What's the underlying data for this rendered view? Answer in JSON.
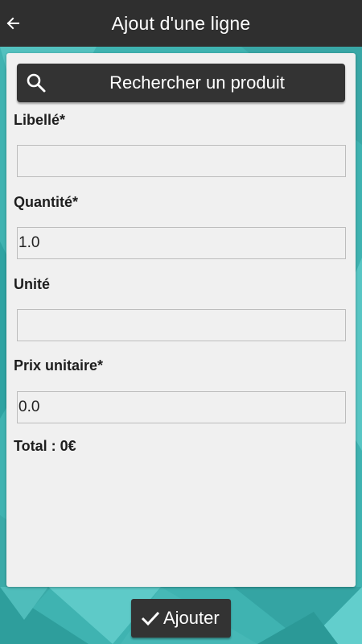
{
  "colors": {
    "appbar": "#2f2f2f",
    "background": "#3fb3b1",
    "card": "#f0f0f0",
    "button": "#333333",
    "button_text": "#ffffff",
    "label_text": "#1e1e1e"
  },
  "appbar": {
    "back_icon": "arrow-left-icon",
    "title": "Ajout d'une ligne"
  },
  "search": {
    "icon": "search-icon",
    "label": "Rechercher un produit"
  },
  "form": {
    "libelle": {
      "label": "Libellé*",
      "value": ""
    },
    "quantite": {
      "label": "Quantité*",
      "value": "1.0"
    },
    "unite": {
      "label": "Unité",
      "value": ""
    },
    "prix_unitaire": {
      "label": "Prix unitaire*",
      "value": "0.0"
    }
  },
  "total": "Total : 0€",
  "submit": {
    "icon": "check-icon",
    "label": "Ajouter"
  }
}
